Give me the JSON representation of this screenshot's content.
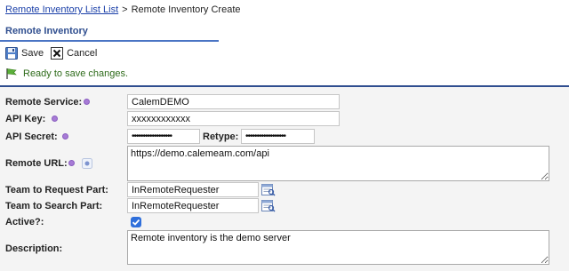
{
  "breadcrumb": {
    "parent": "Remote Inventory List List",
    "separator": ">",
    "current": "Remote Inventory Create"
  },
  "section": {
    "title": "Remote Inventory"
  },
  "toolbar": {
    "save_label": "Save",
    "cancel_label": "Cancel"
  },
  "status": {
    "message": "Ready to save changes."
  },
  "form": {
    "remote_service": {
      "label": "Remote Service:",
      "value": "CalemDEMO"
    },
    "api_key": {
      "label": "API Key:",
      "value": "xxxxxxxxxxxx"
    },
    "api_secret": {
      "label": "API Secret:",
      "value": "••••••••••••••••••",
      "retype_label": "Retype:",
      "retype_value": "••••••••••••••••••"
    },
    "remote_url": {
      "label": "Remote URL:",
      "value": "https://demo.calemeam.com/api"
    },
    "team_request": {
      "label": "Team to Request Part:",
      "value": "InRemoteRequester"
    },
    "team_search": {
      "label": "Team to Search Part:",
      "value": "InRemoteRequester"
    },
    "active": {
      "label": "Active?:",
      "checked": true
    },
    "description": {
      "label": "Description:",
      "value": "Remote inventory is the demo server"
    }
  },
  "colors": {
    "link": "#1a3fa8",
    "section_title": "#2f4e8f",
    "rule": "#2f4e8f",
    "required_dot": "#a77bd6",
    "status_text": "#2e6b1a",
    "checkbox": "#2f6fdb"
  }
}
